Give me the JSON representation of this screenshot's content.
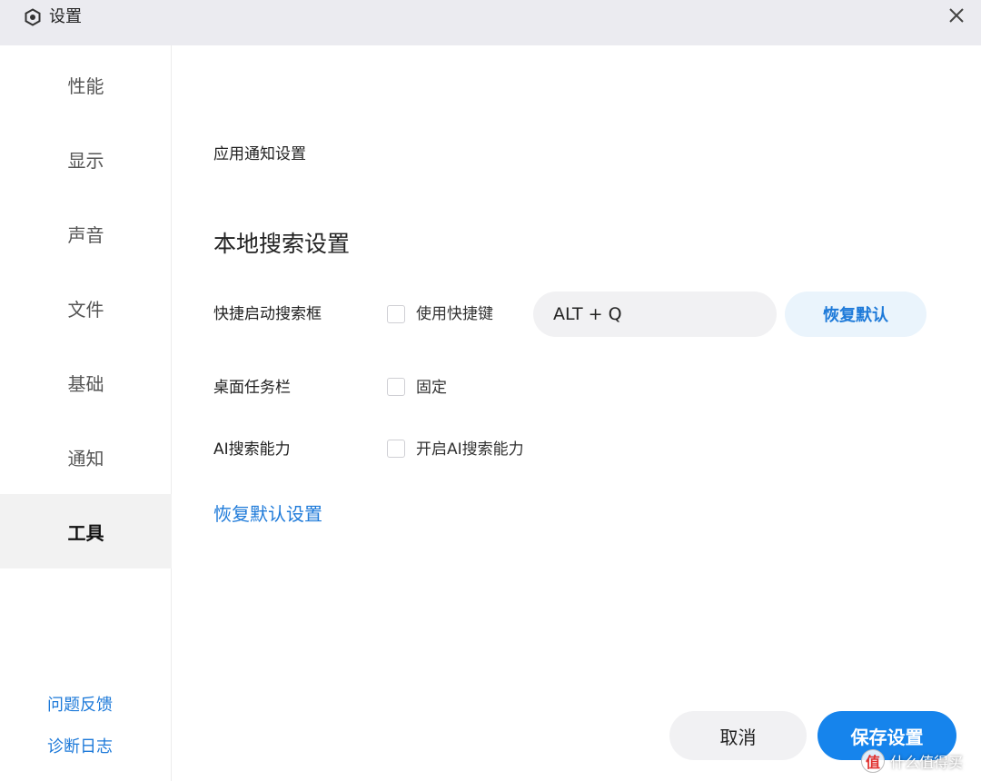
{
  "window": {
    "title": "设置",
    "app_icon": "settings-hexagon-icon",
    "close_icon": "close-icon"
  },
  "sidebar": {
    "items": [
      {
        "label": "性能",
        "active": false
      },
      {
        "label": "显示",
        "active": false
      },
      {
        "label": "声音",
        "active": false
      },
      {
        "label": "文件",
        "active": false
      },
      {
        "label": "基础",
        "active": false
      },
      {
        "label": "通知",
        "active": false
      },
      {
        "label": "工具",
        "active": true
      }
    ],
    "feedback_link": "问题反馈",
    "diagnostics_link": "诊断日志"
  },
  "main": {
    "app_notification_heading": "应用通知设置",
    "local_search_heading": "本地搜索设置",
    "rows": {
      "quick_launch": {
        "label": "快捷启动搜索框",
        "checkbox_label": "使用快捷键",
        "checked": false,
        "shortcut_value": "ALT + Q",
        "reset_button": "恢复默认"
      },
      "taskbar": {
        "label": "桌面任务栏",
        "checkbox_label": "固定",
        "checked": false
      },
      "ai_search": {
        "label": "AI搜索能力",
        "checkbox_label": "开启AI搜索能力",
        "checked": false
      }
    },
    "restore_defaults_link": "恢复默认设置"
  },
  "footer": {
    "cancel_label": "取消",
    "save_label": "保存设置"
  },
  "watermark": {
    "badge": "值",
    "text": "什么值得买"
  },
  "colors": {
    "accent": "#1684ec",
    "link": "#1e7ad9",
    "titlebar_bg": "#ebebf0",
    "active_nav_bg": "#f2f2f2"
  }
}
